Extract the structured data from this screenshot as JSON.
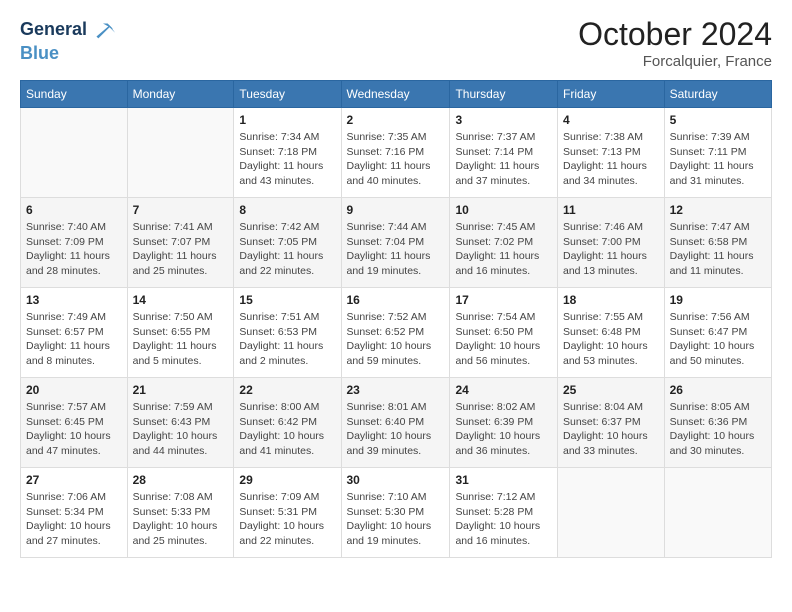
{
  "header": {
    "logo_line1": "General",
    "logo_line2": "Blue",
    "month": "October 2024",
    "location": "Forcalquier, France"
  },
  "weekdays": [
    "Sunday",
    "Monday",
    "Tuesday",
    "Wednesday",
    "Thursday",
    "Friday",
    "Saturday"
  ],
  "weeks": [
    [
      {
        "day": "",
        "info": ""
      },
      {
        "day": "",
        "info": ""
      },
      {
        "day": "1",
        "info": "Sunrise: 7:34 AM\nSunset: 7:18 PM\nDaylight: 11 hours and 43 minutes."
      },
      {
        "day": "2",
        "info": "Sunrise: 7:35 AM\nSunset: 7:16 PM\nDaylight: 11 hours and 40 minutes."
      },
      {
        "day": "3",
        "info": "Sunrise: 7:37 AM\nSunset: 7:14 PM\nDaylight: 11 hours and 37 minutes."
      },
      {
        "day": "4",
        "info": "Sunrise: 7:38 AM\nSunset: 7:13 PM\nDaylight: 11 hours and 34 minutes."
      },
      {
        "day": "5",
        "info": "Sunrise: 7:39 AM\nSunset: 7:11 PM\nDaylight: 11 hours and 31 minutes."
      }
    ],
    [
      {
        "day": "6",
        "info": "Sunrise: 7:40 AM\nSunset: 7:09 PM\nDaylight: 11 hours and 28 minutes."
      },
      {
        "day": "7",
        "info": "Sunrise: 7:41 AM\nSunset: 7:07 PM\nDaylight: 11 hours and 25 minutes."
      },
      {
        "day": "8",
        "info": "Sunrise: 7:42 AM\nSunset: 7:05 PM\nDaylight: 11 hours and 22 minutes."
      },
      {
        "day": "9",
        "info": "Sunrise: 7:44 AM\nSunset: 7:04 PM\nDaylight: 11 hours and 19 minutes."
      },
      {
        "day": "10",
        "info": "Sunrise: 7:45 AM\nSunset: 7:02 PM\nDaylight: 11 hours and 16 minutes."
      },
      {
        "day": "11",
        "info": "Sunrise: 7:46 AM\nSunset: 7:00 PM\nDaylight: 11 hours and 13 minutes."
      },
      {
        "day": "12",
        "info": "Sunrise: 7:47 AM\nSunset: 6:58 PM\nDaylight: 11 hours and 11 minutes."
      }
    ],
    [
      {
        "day": "13",
        "info": "Sunrise: 7:49 AM\nSunset: 6:57 PM\nDaylight: 11 hours and 8 minutes."
      },
      {
        "day": "14",
        "info": "Sunrise: 7:50 AM\nSunset: 6:55 PM\nDaylight: 11 hours and 5 minutes."
      },
      {
        "day": "15",
        "info": "Sunrise: 7:51 AM\nSunset: 6:53 PM\nDaylight: 11 hours and 2 minutes."
      },
      {
        "day": "16",
        "info": "Sunrise: 7:52 AM\nSunset: 6:52 PM\nDaylight: 10 hours and 59 minutes."
      },
      {
        "day": "17",
        "info": "Sunrise: 7:54 AM\nSunset: 6:50 PM\nDaylight: 10 hours and 56 minutes."
      },
      {
        "day": "18",
        "info": "Sunrise: 7:55 AM\nSunset: 6:48 PM\nDaylight: 10 hours and 53 minutes."
      },
      {
        "day": "19",
        "info": "Sunrise: 7:56 AM\nSunset: 6:47 PM\nDaylight: 10 hours and 50 minutes."
      }
    ],
    [
      {
        "day": "20",
        "info": "Sunrise: 7:57 AM\nSunset: 6:45 PM\nDaylight: 10 hours and 47 minutes."
      },
      {
        "day": "21",
        "info": "Sunrise: 7:59 AM\nSunset: 6:43 PM\nDaylight: 10 hours and 44 minutes."
      },
      {
        "day": "22",
        "info": "Sunrise: 8:00 AM\nSunset: 6:42 PM\nDaylight: 10 hours and 41 minutes."
      },
      {
        "day": "23",
        "info": "Sunrise: 8:01 AM\nSunset: 6:40 PM\nDaylight: 10 hours and 39 minutes."
      },
      {
        "day": "24",
        "info": "Sunrise: 8:02 AM\nSunset: 6:39 PM\nDaylight: 10 hours and 36 minutes."
      },
      {
        "day": "25",
        "info": "Sunrise: 8:04 AM\nSunset: 6:37 PM\nDaylight: 10 hours and 33 minutes."
      },
      {
        "day": "26",
        "info": "Sunrise: 8:05 AM\nSunset: 6:36 PM\nDaylight: 10 hours and 30 minutes."
      }
    ],
    [
      {
        "day": "27",
        "info": "Sunrise: 7:06 AM\nSunset: 5:34 PM\nDaylight: 10 hours and 27 minutes."
      },
      {
        "day": "28",
        "info": "Sunrise: 7:08 AM\nSunset: 5:33 PM\nDaylight: 10 hours and 25 minutes."
      },
      {
        "day": "29",
        "info": "Sunrise: 7:09 AM\nSunset: 5:31 PM\nDaylight: 10 hours and 22 minutes."
      },
      {
        "day": "30",
        "info": "Sunrise: 7:10 AM\nSunset: 5:30 PM\nDaylight: 10 hours and 19 minutes."
      },
      {
        "day": "31",
        "info": "Sunrise: 7:12 AM\nSunset: 5:28 PM\nDaylight: 10 hours and 16 minutes."
      },
      {
        "day": "",
        "info": ""
      },
      {
        "day": "",
        "info": ""
      }
    ]
  ]
}
